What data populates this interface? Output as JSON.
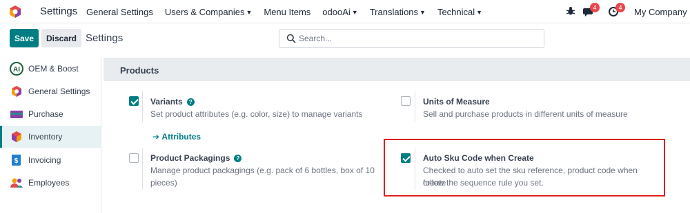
{
  "navbar": {
    "app_title": "Settings",
    "menu": [
      {
        "label": "General Settings",
        "has_caret": false
      },
      {
        "label": "Users & Companies",
        "has_caret": true
      },
      {
        "label": "Menu Items",
        "has_caret": false
      },
      {
        "label": "odooAi",
        "has_caret": true
      },
      {
        "label": "Translations",
        "has_caret": true
      },
      {
        "label": "Technical",
        "has_caret": true
      }
    ],
    "messages_badge": "4",
    "activities_badge": "4",
    "company": "My Company (S"
  },
  "control_panel": {
    "save_label": "Save",
    "discard_label": "Discard",
    "breadcrumb": "Settings",
    "search_placeholder": "Search..."
  },
  "sidebar": {
    "items": [
      {
        "label": "OEM & Boost",
        "icon": "oem-boost-icon",
        "active": false
      },
      {
        "label": "General Settings",
        "icon": "general-settings-icon",
        "active": false
      },
      {
        "label": "Purchase",
        "icon": "purchase-icon",
        "active": false
      },
      {
        "label": "Inventory",
        "icon": "inventory-icon",
        "active": true
      },
      {
        "label": "Invoicing",
        "icon": "invoicing-icon",
        "active": false
      },
      {
        "label": "Employees",
        "icon": "employees-icon",
        "active": false
      }
    ]
  },
  "section": {
    "title": "Products",
    "settings": {
      "variants": {
        "title": "Variants",
        "checked": true,
        "description": "Set product attributes (e.g. color, size) to manage variants",
        "link_label": "Attributes"
      },
      "uom": {
        "title": "Units of Measure",
        "checked": false,
        "description": "Sell and purchase products in different units of measure"
      },
      "packagings": {
        "title": "Product Packagings",
        "checked": false,
        "description_line1": "Manage product packagings (e.g. pack of 6 bottles, box of 10",
        "description_line2": "pieces)"
      },
      "auto_sku": {
        "title": "Auto Sku Code when Create",
        "checked": true,
        "description_line1": "Checked to auto set the sku reference, product code when create",
        "description_line2": "follow the sequence rule you set."
      }
    }
  },
  "colors": {
    "brand": "#017e84",
    "highlight": "#e11d1d"
  }
}
